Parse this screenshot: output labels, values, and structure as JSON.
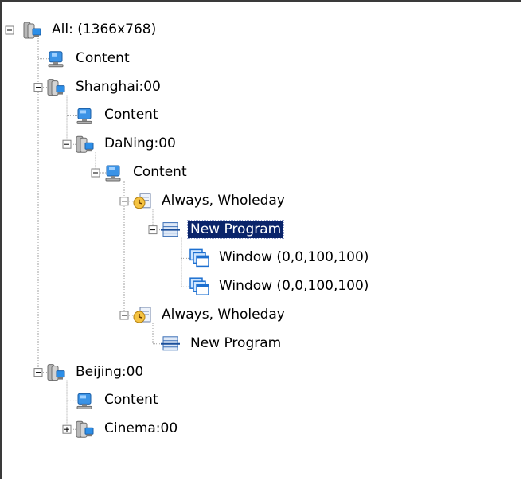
{
  "tree": {
    "selected": "New Program",
    "nodes": [
      {
        "label": "All: (1366x768)",
        "icon": "server-group-icon",
        "depth": 0,
        "expander": "collapse",
        "vline": [
          0
        ]
      },
      {
        "label": "Content",
        "icon": "monitor-icon",
        "depth": 1,
        "expander": "none",
        "vline": [
          1
        ]
      },
      {
        "label": "Shanghai:00",
        "icon": "server-group-icon",
        "depth": 1,
        "expander": "collapse",
        "vline": [
          1,
          2
        ]
      },
      {
        "label": "Content",
        "icon": "monitor-icon",
        "depth": 2,
        "expander": "none",
        "vline": [
          2
        ]
      },
      {
        "label": "DaNing:00",
        "icon": "server-group-icon",
        "depth": 2,
        "expander": "collapse",
        "vline": [
          3
        ]
      },
      {
        "label": "Content",
        "icon": "monitor-icon",
        "depth": 3,
        "expander": "collapse",
        "vline": [
          4
        ]
      },
      {
        "label": "Always, Wholeday",
        "icon": "schedule-icon",
        "depth": 4,
        "expander": "collapse",
        "vline": [
          4,
          5
        ]
      },
      {
        "label": "New Program",
        "icon": "program-icon",
        "depth": 5,
        "expander": "collapse",
        "vline": [
          6
        ]
      },
      {
        "label": "Window (0,0,100,100)",
        "icon": "window-icon",
        "depth": 6,
        "expander": "none",
        "vline": []
      },
      {
        "label": "Window (0,0,100,100)",
        "icon": "window-icon",
        "depth": 6,
        "expander": "none",
        "vline": []
      },
      {
        "label": "Always, Wholeday",
        "icon": "schedule-icon",
        "depth": 4,
        "expander": "collapse",
        "vline": [
          5
        ]
      },
      {
        "label": "New Program",
        "icon": "program-icon",
        "depth": 5,
        "expander": "none",
        "vline": []
      },
      {
        "label": "Beijing:00",
        "icon": "server-group-icon",
        "depth": 1,
        "expander": "collapse",
        "vline": [
          2
        ]
      },
      {
        "label": "Content",
        "icon": "monitor-icon",
        "depth": 2,
        "expander": "none",
        "vline": [
          2
        ]
      },
      {
        "label": "Cinema:00",
        "icon": "server-group-icon",
        "depth": 2,
        "expander": "expand",
        "vline": []
      }
    ]
  },
  "colors": {
    "selection_bg": "#0a246a",
    "selection_fg": "#ffffff",
    "dotted_line": "#a0a0a0"
  }
}
